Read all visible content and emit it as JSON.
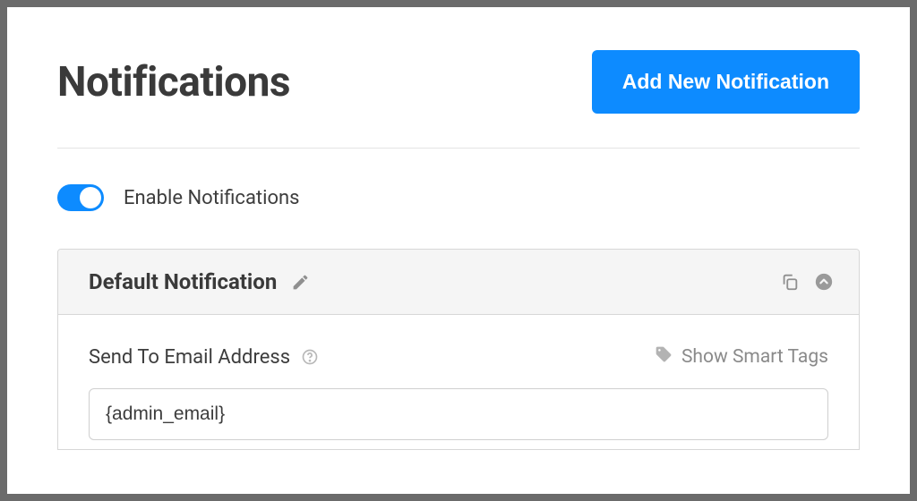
{
  "header": {
    "title": "Notifications",
    "add_button": "Add New Notification"
  },
  "enable_toggle": {
    "label": "Enable Notifications",
    "on": true
  },
  "notification": {
    "title": "Default Notification",
    "send_to_label": "Send To Email Address",
    "smart_tags_link": "Show Smart Tags",
    "email_value": "{admin_email}"
  }
}
